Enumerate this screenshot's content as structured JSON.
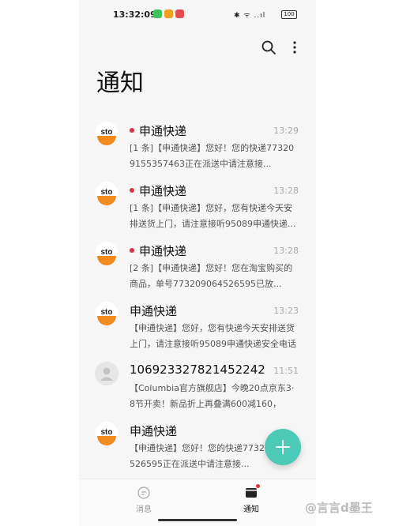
{
  "status_bar": {
    "time": "13:32:09",
    "right_icons": "✱ ᯤ ..ıl",
    "battery": "100"
  },
  "header": {
    "title": "通知"
  },
  "notifications": [
    {
      "sender": "申通快递",
      "unread": true,
      "time": "13:29",
      "preview": "[1 条]【申通快递】您好！您的快递773209155357463正在派送中请注意接...",
      "avatar": "sto"
    },
    {
      "sender": "申通快递",
      "unread": true,
      "time": "13:28",
      "preview": "[1 条]【申通快递】您好，您有快递今天安排送货上门，请注意接听95089申通快递...",
      "avatar": "sto"
    },
    {
      "sender": "申通快递",
      "unread": true,
      "time": "13:28",
      "preview": "[2 条]【申通快递】您好！您在淘宝购买的商品，单号773209064526595已放...",
      "avatar": "sto"
    },
    {
      "sender": "申通快递",
      "unread": false,
      "time": "13:23",
      "preview": "【申通快递】您好，您有快递今天安排送货上门，请注意接听95089申通快递安全电话",
      "avatar": "sto"
    },
    {
      "sender": "106923327821452242",
      "unread": false,
      "time": "11:51",
      "preview": "【Columbia官方旗舰店】今晚20点京东3·8节开卖！新品折上再叠满600减160，速...",
      "avatar": "person"
    },
    {
      "sender": "申通快递",
      "unread": false,
      "time": "",
      "preview": "【申通快递】您好！您的快递773209064526595正在派送中请注意接...",
      "avatar": "sto"
    }
  ],
  "bottom_nav": {
    "tabs": [
      {
        "label": "消息",
        "active": false
      },
      {
        "label": "通知",
        "active": true
      }
    ]
  },
  "watermark": "@言言d墨王",
  "colors": {
    "accent": "#4dc9b7",
    "unread_dot": "#d9343f",
    "sto_orange": "#f08a1d"
  }
}
